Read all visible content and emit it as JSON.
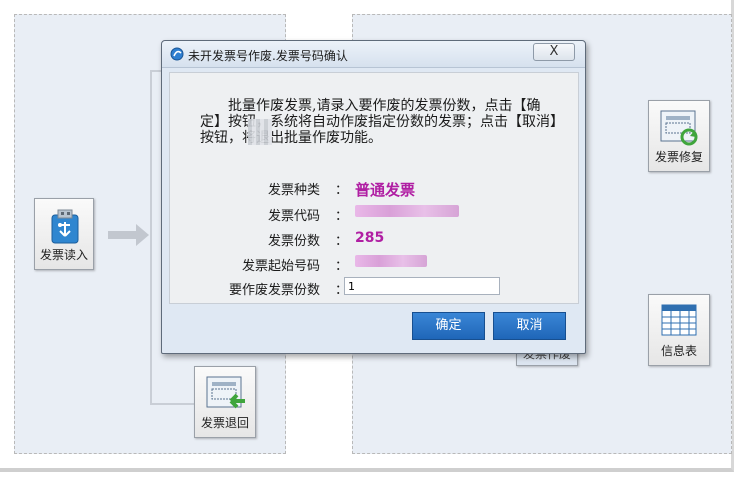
{
  "workflow": {
    "tiles": {
      "read": "发票读入",
      "return": "发票退回",
      "repair": "发票修复",
      "info": "信息表",
      "void_partial": "发票作废"
    }
  },
  "dialog": {
    "title": "未开发票号作废.发票号码确认",
    "close_label": "X",
    "message": "批量作废发票,请录入要作废的发票份数，点击【确定】按钮，系统将自动作废指定份数的发票；点击【取消】按钮，将退出批量作废功能。",
    "fields": {
      "type_label": "发票种类",
      "type_value": "普通发票",
      "code_label": "发票代码",
      "count_label": "发票份数",
      "count_value": "285",
      "start_label": "发票起始号码",
      "void_label": "要作废发票份数",
      "colon": "："
    },
    "void_input_value": "1",
    "buttons": {
      "confirm": "确定",
      "cancel": "取消"
    }
  },
  "colors": {
    "accent_button": "#2a76c8",
    "value_highlight": "#b01fa3",
    "panel_bg": "#e9eef5"
  },
  "icons": [
    "usb-drive-icon",
    "invoice-return-icon",
    "invoice-repair-icon",
    "table-icon",
    "dialog-app-icon"
  ]
}
